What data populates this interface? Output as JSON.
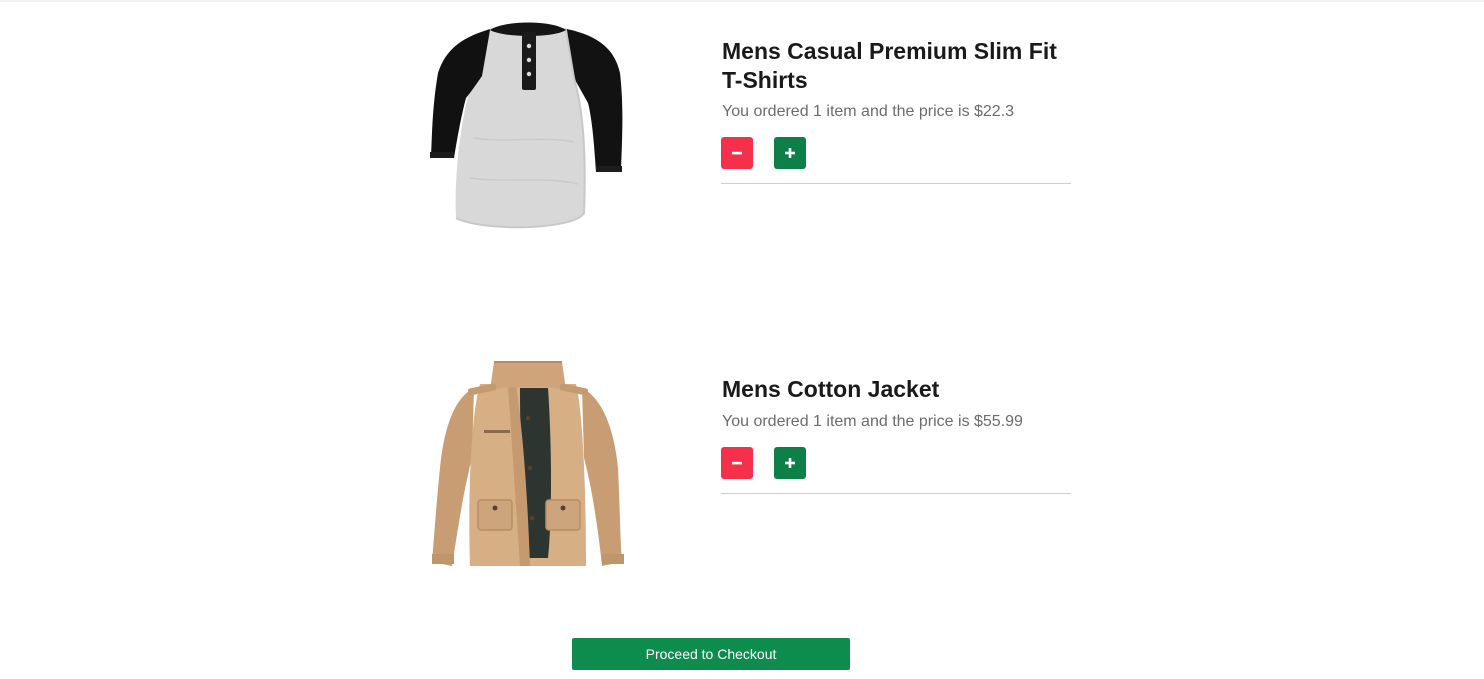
{
  "cart": {
    "items": [
      {
        "title": "Mens Casual Premium Slim Fit T-Shirts",
        "summary": "You ordered 1 item and the price is $22.3",
        "image_icon": "raglan-henley-tshirt",
        "decrease_icon": "minus-icon",
        "increase_icon": "plus-icon"
      },
      {
        "title": "Mens Cotton Jacket",
        "summary": "You ordered 1 item and the price is $55.99",
        "image_icon": "cotton-jacket",
        "decrease_icon": "minus-icon",
        "increase_icon": "plus-icon"
      }
    ],
    "checkout_label": "Proceed to Checkout"
  },
  "colors": {
    "decrease_button": "#f4304a",
    "increase_button": "#0d8048",
    "checkout_button": "#0d8c4e"
  }
}
